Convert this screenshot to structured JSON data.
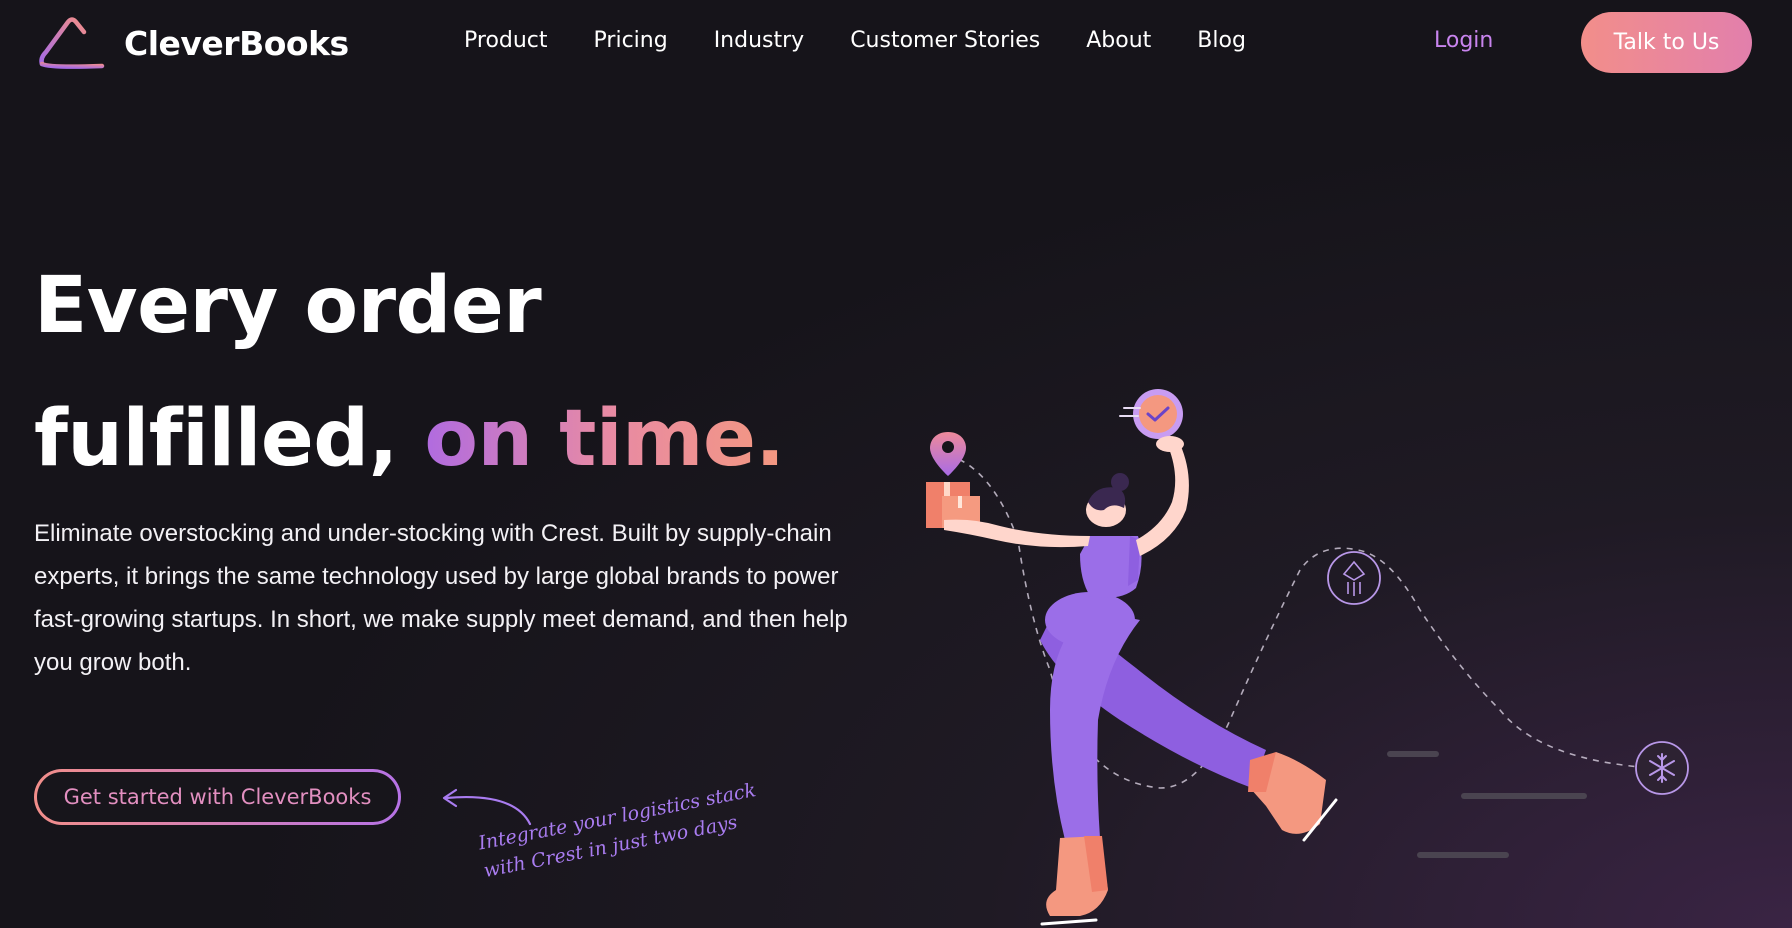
{
  "brand": {
    "name": "CleverBooks"
  },
  "nav": {
    "items": [
      {
        "label": "Product"
      },
      {
        "label": "Pricing"
      },
      {
        "label": "Industry"
      },
      {
        "label": "Customer Stories"
      },
      {
        "label": "About"
      },
      {
        "label": "Blog"
      }
    ],
    "login_label": "Login",
    "cta_label": "Talk to Us"
  },
  "hero": {
    "headline_line1": "Every order",
    "headline_line2_plain": "fulfilled,",
    "headline_line2_highlight": "on time.",
    "description": "Eliminate overstocking and under-stocking with Crest. Built by supply-chain experts, it brings the same technology used by large global brands to power fast-growing startups. In short, we make supply meet demand, and then help you grow both.",
    "cta_label": "Get started with CleverBooks",
    "annotation_line1": "Integrate your logistics stack",
    "annotation_line2": "with Crest in just two days"
  },
  "colors": {
    "background": "#17151b",
    "accent_purple": "#9b6ee8",
    "accent_coral": "#f28e8a",
    "login": "#c884ee"
  },
  "icons": [
    "logo-triangle-icon",
    "location-pin-icon",
    "box-icon",
    "clock-check-icon",
    "lantern-icon",
    "snowflake-icon",
    "curved-arrow-icon"
  ]
}
